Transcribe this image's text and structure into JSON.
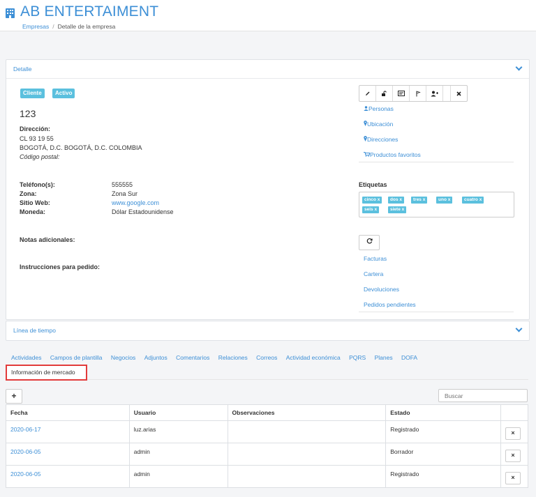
{
  "app": {
    "title": "AB ENTERTAIMENT"
  },
  "breadcrumb": {
    "root": "Empresas",
    "separator": "/",
    "current": "Detalle de la empresa"
  },
  "detail": {
    "panel_title": "Detalle",
    "badges": [
      "Cliente",
      "Activo"
    ],
    "code": "123",
    "address_label": "Dirección:",
    "address_line1": "CL 93 19 55",
    "address_line2": "BOGOTÁ, D.C. BOGOTÁ, D.C. COLOMBIA",
    "postal_label": "Código postal:",
    "phone_label": "Teléfono(s):",
    "phone_value": "555555",
    "zone_label": "Zona:",
    "zone_value": "Zona Sur",
    "web_label": "Sitio Web:",
    "web_value": "www.google.com",
    "currency_label": "Moneda:",
    "currency_value": "Dólar Estadounidense",
    "notes_label": "Notas adicionales:",
    "instructions_label": "Instrucciones para pedido:"
  },
  "toolbar": {
    "icons": [
      "pencil-icon",
      "unlock-icon",
      "id-card-icon",
      "flag-icon",
      "add-user-icon",
      "close-icon"
    ]
  },
  "side_links": {
    "personas": "Personas",
    "ubicacion": "Ubicación",
    "direcciones": "Direcciones",
    "productos": "Productos favoritos"
  },
  "tags": {
    "label": "Etiquetas",
    "items": [
      "cinco",
      "dos",
      "tres",
      "uno",
      "cuatro",
      "seis",
      "siete"
    ],
    "remove_glyph": "x"
  },
  "docs": {
    "facturas": "Facturas",
    "cartera": "Cartera",
    "devoluciones": "Devoluciones",
    "pendientes": "Pedidos pendientes"
  },
  "timeline": {
    "panel_title": "Línea de tiempo"
  },
  "tabs": [
    "Actividades",
    "Campos de plantilla",
    "Negocios",
    "Adjuntos",
    "Comentarios",
    "Relaciones",
    "Correos",
    "Actividad económica",
    "PQRS",
    "Planes",
    "DOFA"
  ],
  "active_tab": "Información de mercado",
  "table": {
    "add_label": "+",
    "search_placeholder": "Buscar",
    "headers": [
      "Fecha",
      "Usuario",
      "Observaciones",
      "Estado",
      ""
    ],
    "rows": [
      {
        "fecha": "2020-06-17",
        "usuario": "luz.arias",
        "observaciones": "",
        "estado": "Registrado"
      },
      {
        "fecha": "2020-06-05",
        "usuario": "admin",
        "observaciones": "",
        "estado": "Borrador"
      },
      {
        "fecha": "2020-06-05",
        "usuario": "admin",
        "observaciones": "",
        "estado": "Registrado"
      }
    ],
    "delete_glyph": "×"
  },
  "colors": {
    "accent": "#3d8fd6",
    "badge": "#5bc0de",
    "highlight": "#e23b3b"
  }
}
